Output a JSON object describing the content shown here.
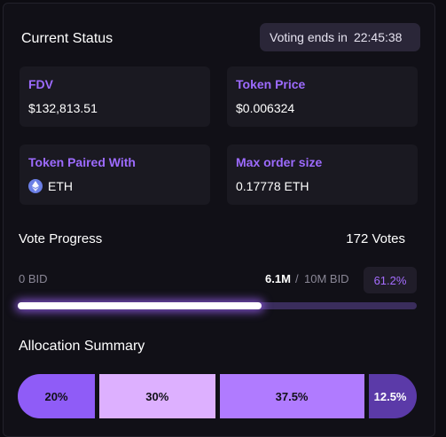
{
  "header": {
    "title": "Current Status",
    "voting_label": "Voting ends in",
    "voting_time": "22:45:38"
  },
  "stats": {
    "fdv": {
      "label": "FDV",
      "value": "$132,813.51"
    },
    "token_price": {
      "label": "Token Price",
      "value": "$0.006324"
    },
    "token_paired": {
      "label": "Token Paired With",
      "value": "ETH",
      "icon": "ethereum-icon"
    },
    "max_order": {
      "label": "Max order size",
      "value": "0.17778 ETH"
    }
  },
  "vote_progress": {
    "title": "Vote Progress",
    "votes": "172 Votes",
    "min_label": "0 BID",
    "current": "6.1M",
    "separator": "/",
    "max_label": "10M BID",
    "percent_label": "61.2%",
    "fraction": 0.612
  },
  "allocation": {
    "title": "Allocation Summary",
    "segments": [
      {
        "label": "20%",
        "value": 20,
        "color": "#8f5cf7"
      },
      {
        "label": "30%",
        "value": 30,
        "color": "#ddb0ff"
      },
      {
        "label": "37.5%",
        "value": 37.5,
        "color": "#b07bff"
      },
      {
        "label": "12.5%",
        "value": 12.5,
        "color": "#5b3aa8"
      }
    ]
  },
  "colors": {
    "accent": "#9d6bff",
    "background": "#111017",
    "card": "#1a1921"
  }
}
